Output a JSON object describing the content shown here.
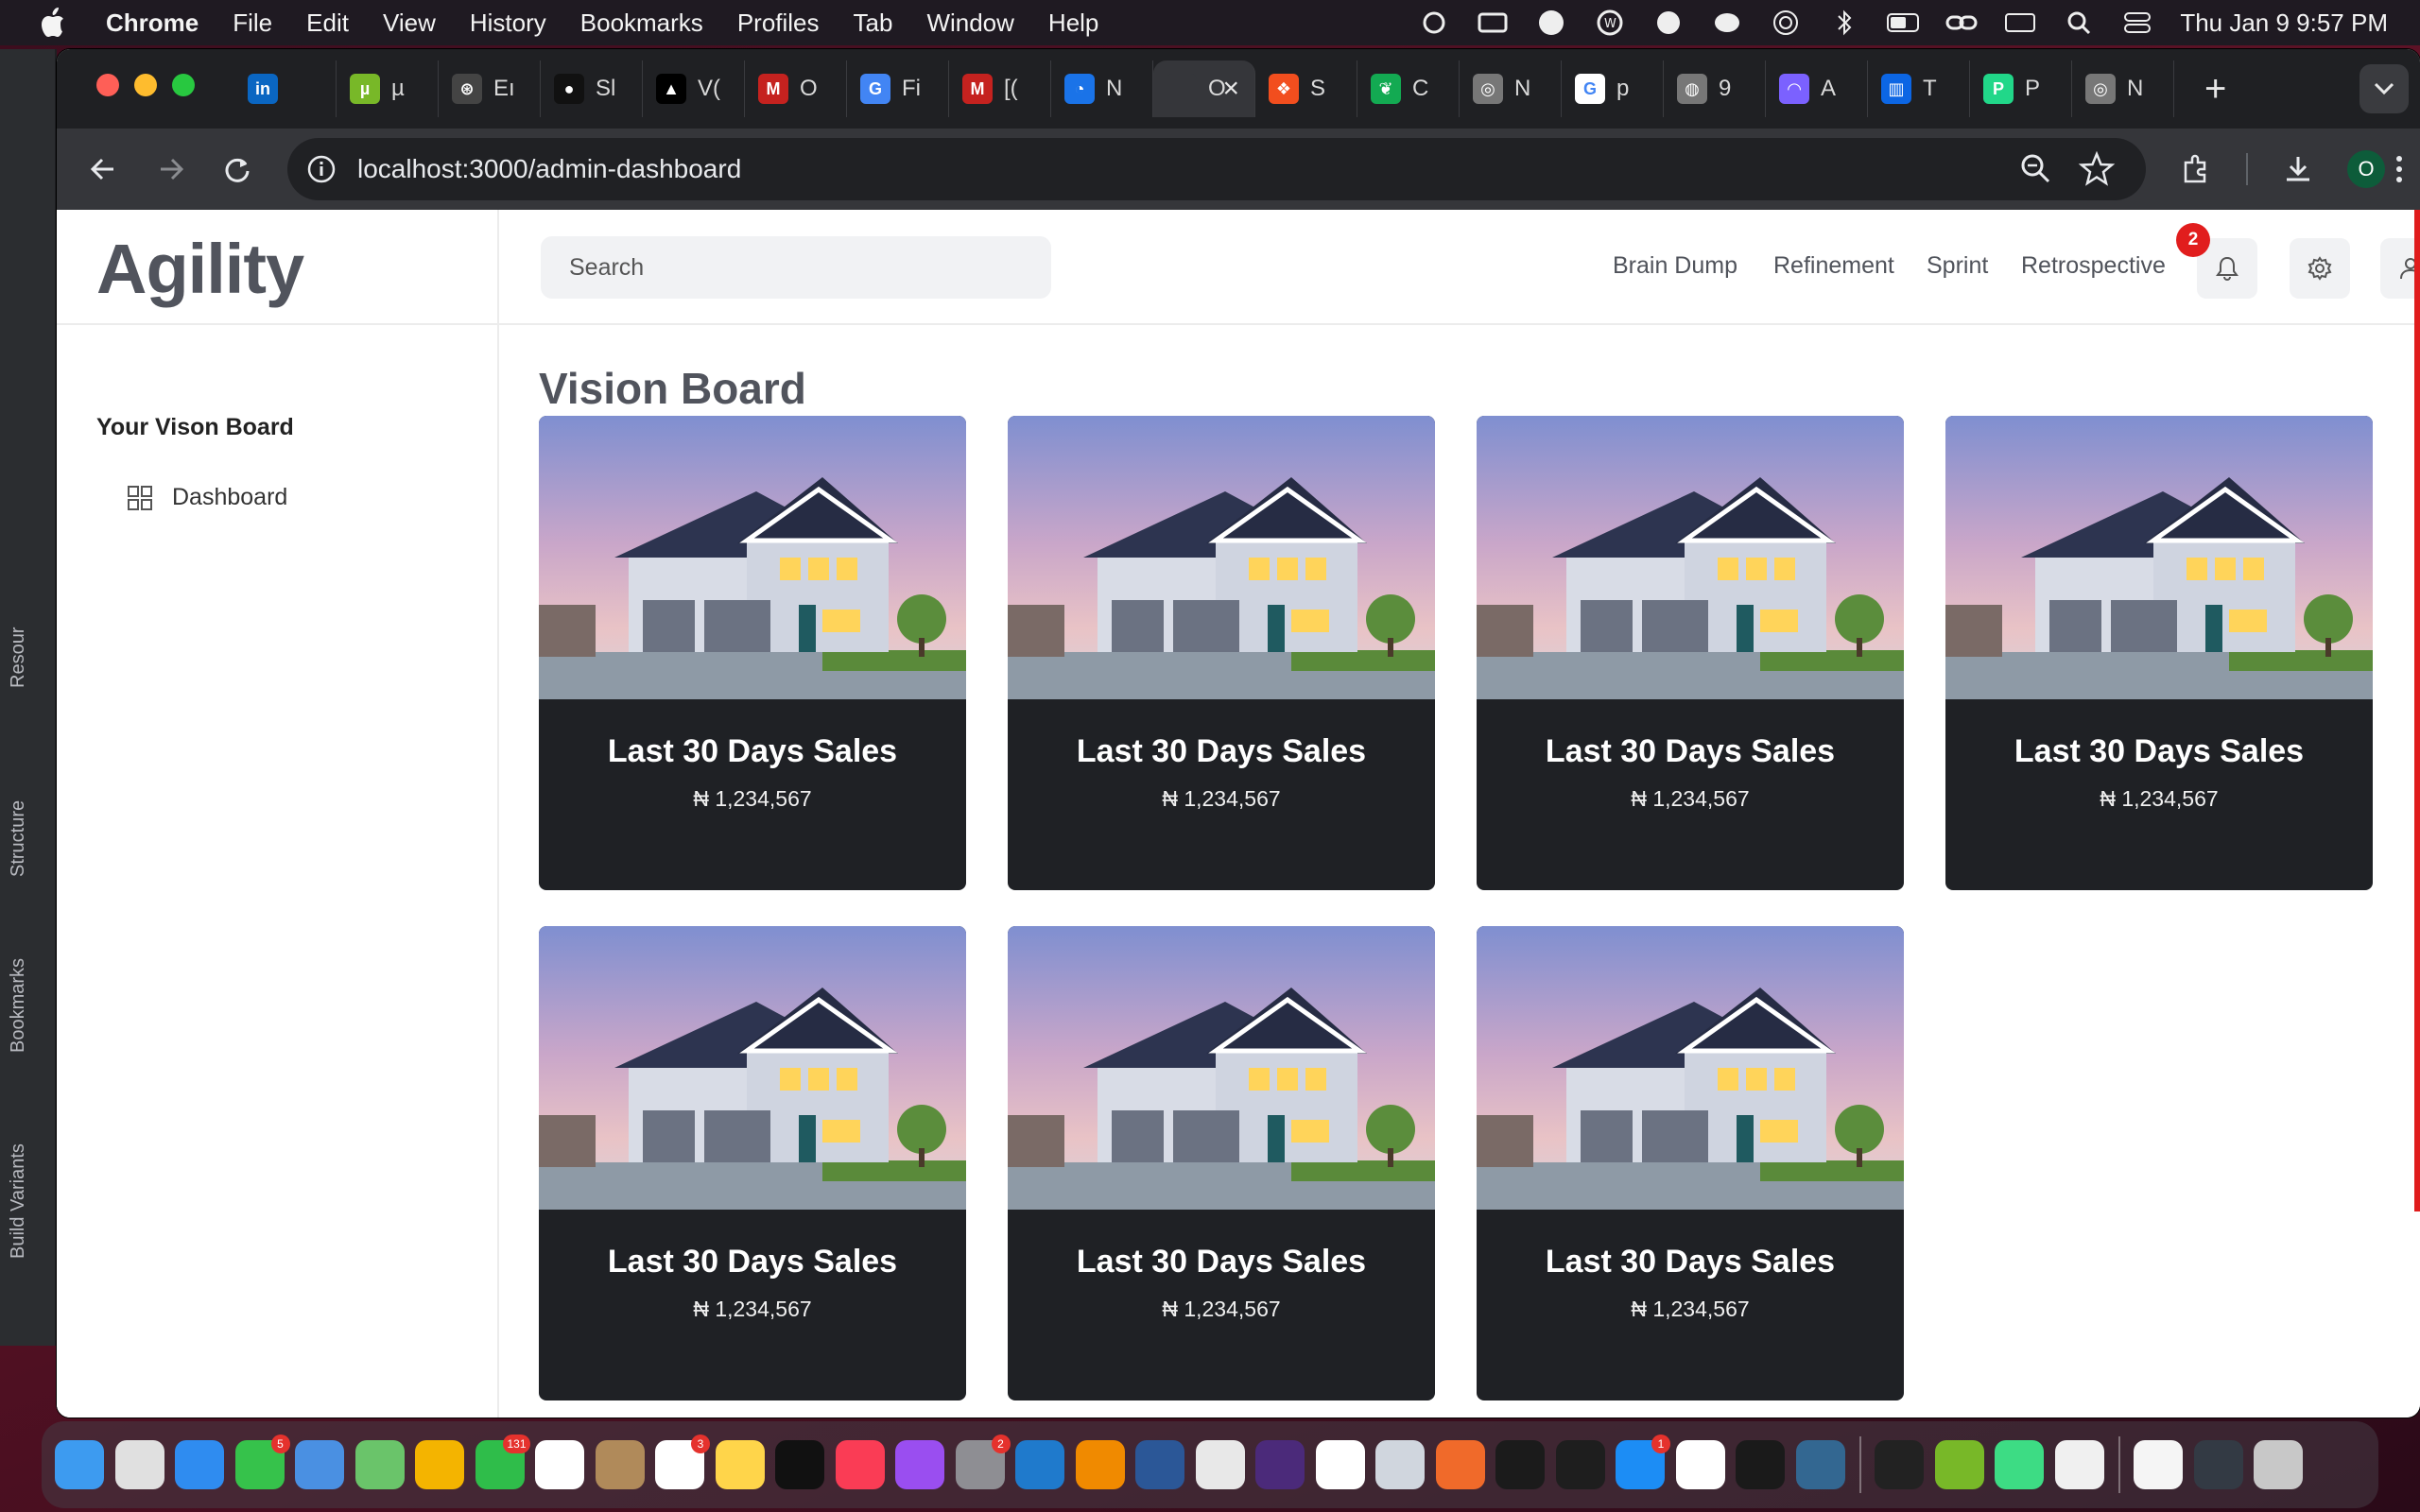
{
  "menubar": {
    "app_name": "Chrome",
    "items": [
      "File",
      "Edit",
      "View",
      "History",
      "Bookmarks",
      "Profiles",
      "Tab",
      "Window",
      "Help"
    ],
    "clock": "Thu Jan 9  9:57 PM"
  },
  "ide_strip": {
    "labels": [
      "Resour",
      "Structure",
      "Bookmarks",
      "Build Variants"
    ]
  },
  "browser": {
    "tabs": [
      {
        "label": "",
        "icon": "linkedin-icon",
        "color": "#0a66c2",
        "glyph": "in"
      },
      {
        "label": "µ",
        "icon": "utorrent-icon",
        "color": "#78b828",
        "glyph": "µ"
      },
      {
        "label": "Eı",
        "icon": "openai-icon",
        "color": "#444",
        "glyph": "⊛"
      },
      {
        "label": "Sl",
        "icon": "github-icon",
        "color": "#111",
        "glyph": "●"
      },
      {
        "label": "V(",
        "icon": "vercel-icon",
        "color": "#000",
        "glyph": "▲"
      },
      {
        "label": "O",
        "icon": "gmail-icon",
        "color": "#c5221f",
        "glyph": "M"
      },
      {
        "label": "Fi",
        "icon": "firebase-icon",
        "color": "#4285f4",
        "glyph": "G"
      },
      {
        "label": "[(",
        "icon": "gmail-icon",
        "color": "#c5221f",
        "glyph": "M"
      },
      {
        "label": "N",
        "icon": "loading-icon",
        "color": "#1a73e8",
        "glyph": "◔"
      },
      {
        "label": "O",
        "icon": "page-icon",
        "color": "#35363a",
        "glyph": "",
        "active": true
      },
      {
        "label": "S",
        "icon": "figma-icon",
        "color": "#f24e1e",
        "glyph": "❖"
      },
      {
        "label": "C",
        "icon": "mongodb-icon",
        "color": "#13aa52",
        "glyph": "❦"
      },
      {
        "label": "N",
        "icon": "chrome-icon",
        "color": "#777",
        "glyph": "◎"
      },
      {
        "label": "p",
        "icon": "google-icon",
        "color": "#ffffff",
        "glyph": "G"
      },
      {
        "label": "9",
        "icon": "globe-icon",
        "color": "#777",
        "glyph": "◍"
      },
      {
        "label": "A",
        "icon": "arc-icon",
        "color": "#7b61ff",
        "glyph": "◠"
      },
      {
        "label": "T",
        "icon": "trello-icon",
        "color": "#0c66e4",
        "glyph": "▥"
      },
      {
        "label": "P",
        "icon": "pycharm-icon",
        "color": "#21d789",
        "glyph": "P"
      },
      {
        "label": "N",
        "icon": "chrome-icon",
        "color": "#777",
        "glyph": "◎"
      }
    ],
    "new_tab": "+",
    "url": "localhost:3000/admin-dashboard",
    "profile_initial": "O"
  },
  "app": {
    "logo": "Agility",
    "search": {
      "placeholder": "Search",
      "value": ""
    },
    "nav_links": [
      "Brain Dump",
      "Refinement",
      "Sprint",
      "Retrospective"
    ],
    "notification_count": "2",
    "sidebar": {
      "section_title": "Your Vison Board",
      "items": [
        {
          "label": "Dashboard",
          "icon": "grid-icon"
        }
      ]
    },
    "page_title": "Vision Board",
    "cards": [
      {
        "title": "Last 30 Days Sales",
        "value": "₦ 1,234,567"
      },
      {
        "title": "Last 30 Days Sales",
        "value": "₦ 1,234,567"
      },
      {
        "title": "Last 30 Days Sales",
        "value": "₦ 1,234,567"
      },
      {
        "title": "Last 30 Days Sales",
        "value": "₦ 1,234,567"
      },
      {
        "title": "Last 30 Days Sales",
        "value": "₦ 1,234,567"
      },
      {
        "title": "Last 30 Days Sales",
        "value": "₦ 1,234,567"
      },
      {
        "title": "Last 30 Days Sales",
        "value": "₦ 1,234,567"
      }
    ]
  },
  "dock": {
    "apps": [
      {
        "icon": "finder-icon",
        "color": "#3d9bf0"
      },
      {
        "icon": "launchpad-icon",
        "color": "#e0e0e0"
      },
      {
        "icon": "safari-icon",
        "color": "#2f8cf0"
      },
      {
        "icon": "messages-icon",
        "color": "#36c24b",
        "badge": "5"
      },
      {
        "icon": "mail-icon",
        "color": "#4a90e2"
      },
      {
        "icon": "maps-icon",
        "color": "#6ac46a"
      },
      {
        "icon": "photos-icon",
        "color": "#f4b400"
      },
      {
        "icon": "facetime-icon",
        "color": "#2fbd4a",
        "badge": "131"
      },
      {
        "icon": "calendar-icon",
        "color": "#ffffff"
      },
      {
        "icon": "contacts-icon",
        "color": "#b08a5a"
      },
      {
        "icon": "reminders-icon",
        "color": "#ffffff",
        "badge": "3"
      },
      {
        "icon": "notes-icon",
        "color": "#ffd54a"
      },
      {
        "icon": "tv-icon",
        "color": "#111111"
      },
      {
        "icon": "music-icon",
        "color": "#fa3c55"
      },
      {
        "icon": "podcasts-icon",
        "color": "#9a4ef0"
      },
      {
        "icon": "system-settings-icon",
        "color": "#8e8e93",
        "badge": "2"
      },
      {
        "icon": "vscode-icon",
        "color": "#1f7acc"
      },
      {
        "icon": "vlc-icon",
        "color": "#f08a00"
      },
      {
        "icon": "word-icon",
        "color": "#2b5797"
      },
      {
        "icon": "chrome-icon",
        "color": "#e8e8e8"
      },
      {
        "icon": "tor-icon",
        "color": "#4b2a7a"
      },
      {
        "icon": "mongodb-compass-icon",
        "color": "#ffffff"
      },
      {
        "icon": "preview-icon",
        "color": "#d0d6de"
      },
      {
        "icon": "pen-icon",
        "color": "#f06a2a"
      },
      {
        "icon": "terminal-icon",
        "color": "#1b1b1b"
      },
      {
        "icon": "figma-icon",
        "color": "#1e1e1e"
      },
      {
        "icon": "app-store-icon",
        "color": "#1c8df5",
        "badge": "1"
      },
      {
        "icon": "slack-icon",
        "color": "#ffffff"
      },
      {
        "icon": "pycharm-icon",
        "color": "#1a1a1a"
      },
      {
        "icon": "postgres-icon",
        "color": "#336791"
      },
      {
        "icon": "wakatime-icon",
        "color": "#222222"
      },
      {
        "icon": "utorrent-icon",
        "color": "#78b828"
      },
      {
        "icon": "android-studio-icon",
        "color": "#3ddc84"
      },
      {
        "icon": "simulator-icon",
        "color": "#f0f0f0"
      },
      {
        "icon": "document-icon",
        "color": "#f5f5f5"
      },
      {
        "icon": "screens-icon",
        "color": "#333a44"
      },
      {
        "icon": "trash-icon",
        "color": "#c8c8c8"
      }
    ]
  },
  "colors": {
    "accent_red": "#e11d1d",
    "card_bg": "#1f2125",
    "logo_gray": "#51545d"
  }
}
